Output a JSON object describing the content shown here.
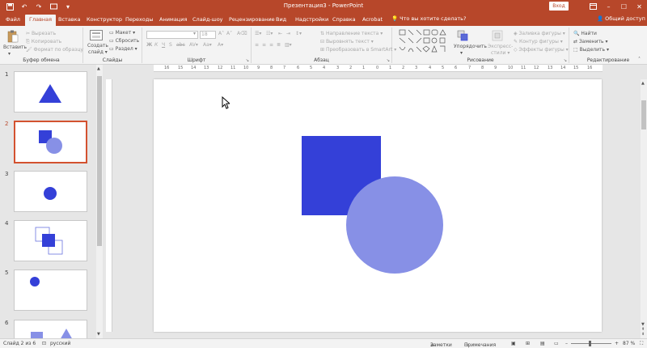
{
  "titlebar": {
    "doc_title": "Презентация3 - PowerPoint",
    "login_label": "Вход",
    "accent": "#b7472a"
  },
  "tabs": [
    {
      "label": "Файл"
    },
    {
      "label": "Главная"
    },
    {
      "label": "Вставка"
    },
    {
      "label": "Конструктор"
    },
    {
      "label": "Переходы"
    },
    {
      "label": "Анимация"
    },
    {
      "label": "Слайд-шоу"
    },
    {
      "label": "Рецензирование"
    },
    {
      "label": "Вид"
    },
    {
      "label": "Надстройки"
    },
    {
      "label": "Справка"
    },
    {
      "label": "Acrobat"
    }
  ],
  "tell_me": "Что вы хотите сделать?",
  "share": "Общий доступ",
  "ribbon": {
    "clipboard": {
      "paste": "Вставить",
      "cut": "Вырезать",
      "copy": "Копировать",
      "format_painter": "Формат по образцу",
      "group": "Буфер обмена"
    },
    "slides": {
      "new_slide_1": "Создать",
      "new_slide_2": "слайд",
      "layout": "Макет",
      "reset": "Сбросить",
      "section": "Раздел",
      "group": "Слайды"
    },
    "font": {
      "size": "18",
      "group": "Шрифт"
    },
    "paragraph": {
      "text_direction": "Направление текста",
      "align_text": "Выровнять текст",
      "smartart": "Преобразовать в SmartArt",
      "group": "Абзац"
    },
    "drawing": {
      "arrange": "Упорядочить",
      "quick_styles_1": "Экспресс-",
      "quick_styles_2": "стили",
      "fill": "Заливка фигуры",
      "outline": "Контур фигуры",
      "effects": "Эффекты фигуры",
      "group": "Рисование"
    },
    "editing": {
      "find": "Найти",
      "replace": "Заменить",
      "select": "Выделить",
      "group": "Редактирование"
    }
  },
  "ruler_ticks": [
    "16",
    "15",
    "14",
    "13",
    "12",
    "11",
    "10",
    "9",
    "8",
    "7",
    "6",
    "5",
    "4",
    "3",
    "2",
    "1",
    "0",
    "1",
    "2",
    "3",
    "4",
    "5",
    "6",
    "7",
    "8",
    "9",
    "10",
    "11",
    "12",
    "13",
    "14",
    "15",
    "16"
  ],
  "slides": [
    {
      "num": "1"
    },
    {
      "num": "2"
    },
    {
      "num": "3"
    },
    {
      "num": "4"
    },
    {
      "num": "5"
    },
    {
      "num": "6"
    }
  ],
  "colors": {
    "shape_dark": "#3440d8",
    "shape_light": "#8790e6",
    "selected_border": "#d35230"
  },
  "status": {
    "slide_info": "Слайд 2 из 6",
    "language": "русский",
    "notes": "Заметки",
    "comments": "Примечания",
    "zoom": "87 %"
  }
}
